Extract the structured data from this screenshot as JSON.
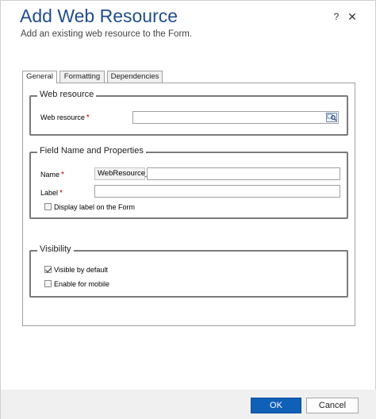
{
  "dialog": {
    "title": "Add Web Resource",
    "subtitle": "Add an existing web resource to the Form.",
    "help_label": "?",
    "close_label": "✕"
  },
  "tabs": [
    {
      "label": "General",
      "active": true
    },
    {
      "label": "Formatting",
      "active": false
    },
    {
      "label": "Dependencies",
      "active": false
    }
  ],
  "web_resource_section": {
    "legend": "Web resource",
    "field_label": "Web resource",
    "required_marker": "*",
    "value": ""
  },
  "field_name_section": {
    "legend": "Field Name and Properties",
    "name_label": "Name",
    "name_prefix": "WebResource_",
    "name_value": "",
    "label_label": "Label",
    "label_value": "",
    "required_marker": "*",
    "display_label_checkbox": {
      "label": "Display label on the Form",
      "checked": false
    }
  },
  "visibility_section": {
    "legend": "Visibility",
    "visible_by_default": {
      "label": "Visible by default",
      "checked": true
    },
    "enable_for_mobile": {
      "label": "Enable for mobile",
      "checked": false
    }
  },
  "footer": {
    "ok_label": "OK",
    "cancel_label": "Cancel",
    "primary_color": "#1160b7"
  }
}
